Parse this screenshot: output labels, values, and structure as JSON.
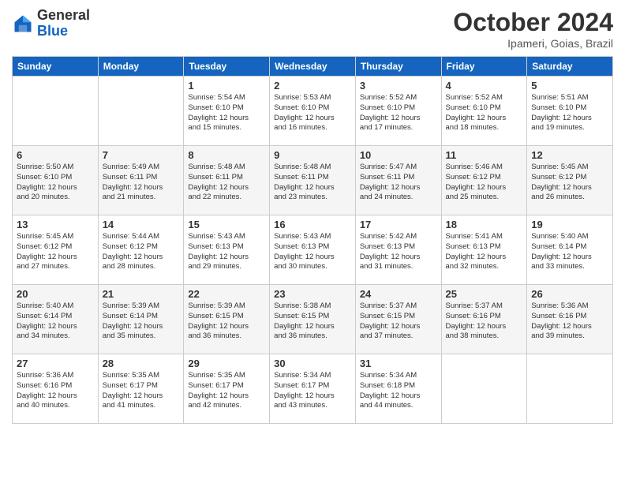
{
  "header": {
    "logo_line1": "General",
    "logo_line2": "Blue",
    "month": "October 2024",
    "location": "Ipameri, Goias, Brazil"
  },
  "days_of_week": [
    "Sunday",
    "Monday",
    "Tuesday",
    "Wednesday",
    "Thursday",
    "Friday",
    "Saturday"
  ],
  "weeks": [
    [
      {
        "day": "",
        "info": ""
      },
      {
        "day": "",
        "info": ""
      },
      {
        "day": "1",
        "info": "Sunrise: 5:54 AM\nSunset: 6:10 PM\nDaylight: 12 hours\nand 15 minutes."
      },
      {
        "day": "2",
        "info": "Sunrise: 5:53 AM\nSunset: 6:10 PM\nDaylight: 12 hours\nand 16 minutes."
      },
      {
        "day": "3",
        "info": "Sunrise: 5:52 AM\nSunset: 6:10 PM\nDaylight: 12 hours\nand 17 minutes."
      },
      {
        "day": "4",
        "info": "Sunrise: 5:52 AM\nSunset: 6:10 PM\nDaylight: 12 hours\nand 18 minutes."
      },
      {
        "day": "5",
        "info": "Sunrise: 5:51 AM\nSunset: 6:10 PM\nDaylight: 12 hours\nand 19 minutes."
      }
    ],
    [
      {
        "day": "6",
        "info": "Sunrise: 5:50 AM\nSunset: 6:10 PM\nDaylight: 12 hours\nand 20 minutes."
      },
      {
        "day": "7",
        "info": "Sunrise: 5:49 AM\nSunset: 6:11 PM\nDaylight: 12 hours\nand 21 minutes."
      },
      {
        "day": "8",
        "info": "Sunrise: 5:48 AM\nSunset: 6:11 PM\nDaylight: 12 hours\nand 22 minutes."
      },
      {
        "day": "9",
        "info": "Sunrise: 5:48 AM\nSunset: 6:11 PM\nDaylight: 12 hours\nand 23 minutes."
      },
      {
        "day": "10",
        "info": "Sunrise: 5:47 AM\nSunset: 6:11 PM\nDaylight: 12 hours\nand 24 minutes."
      },
      {
        "day": "11",
        "info": "Sunrise: 5:46 AM\nSunset: 6:12 PM\nDaylight: 12 hours\nand 25 minutes."
      },
      {
        "day": "12",
        "info": "Sunrise: 5:45 AM\nSunset: 6:12 PM\nDaylight: 12 hours\nand 26 minutes."
      }
    ],
    [
      {
        "day": "13",
        "info": "Sunrise: 5:45 AM\nSunset: 6:12 PM\nDaylight: 12 hours\nand 27 minutes."
      },
      {
        "day": "14",
        "info": "Sunrise: 5:44 AM\nSunset: 6:12 PM\nDaylight: 12 hours\nand 28 minutes."
      },
      {
        "day": "15",
        "info": "Sunrise: 5:43 AM\nSunset: 6:13 PM\nDaylight: 12 hours\nand 29 minutes."
      },
      {
        "day": "16",
        "info": "Sunrise: 5:43 AM\nSunset: 6:13 PM\nDaylight: 12 hours\nand 30 minutes."
      },
      {
        "day": "17",
        "info": "Sunrise: 5:42 AM\nSunset: 6:13 PM\nDaylight: 12 hours\nand 31 minutes."
      },
      {
        "day": "18",
        "info": "Sunrise: 5:41 AM\nSunset: 6:13 PM\nDaylight: 12 hours\nand 32 minutes."
      },
      {
        "day": "19",
        "info": "Sunrise: 5:40 AM\nSunset: 6:14 PM\nDaylight: 12 hours\nand 33 minutes."
      }
    ],
    [
      {
        "day": "20",
        "info": "Sunrise: 5:40 AM\nSunset: 6:14 PM\nDaylight: 12 hours\nand 34 minutes."
      },
      {
        "day": "21",
        "info": "Sunrise: 5:39 AM\nSunset: 6:14 PM\nDaylight: 12 hours\nand 35 minutes."
      },
      {
        "day": "22",
        "info": "Sunrise: 5:39 AM\nSunset: 6:15 PM\nDaylight: 12 hours\nand 36 minutes."
      },
      {
        "day": "23",
        "info": "Sunrise: 5:38 AM\nSunset: 6:15 PM\nDaylight: 12 hours\nand 36 minutes."
      },
      {
        "day": "24",
        "info": "Sunrise: 5:37 AM\nSunset: 6:15 PM\nDaylight: 12 hours\nand 37 minutes."
      },
      {
        "day": "25",
        "info": "Sunrise: 5:37 AM\nSunset: 6:16 PM\nDaylight: 12 hours\nand 38 minutes."
      },
      {
        "day": "26",
        "info": "Sunrise: 5:36 AM\nSunset: 6:16 PM\nDaylight: 12 hours\nand 39 minutes."
      }
    ],
    [
      {
        "day": "27",
        "info": "Sunrise: 5:36 AM\nSunset: 6:16 PM\nDaylight: 12 hours\nand 40 minutes."
      },
      {
        "day": "28",
        "info": "Sunrise: 5:35 AM\nSunset: 6:17 PM\nDaylight: 12 hours\nand 41 minutes."
      },
      {
        "day": "29",
        "info": "Sunrise: 5:35 AM\nSunset: 6:17 PM\nDaylight: 12 hours\nand 42 minutes."
      },
      {
        "day": "30",
        "info": "Sunrise: 5:34 AM\nSunset: 6:17 PM\nDaylight: 12 hours\nand 43 minutes."
      },
      {
        "day": "31",
        "info": "Sunrise: 5:34 AM\nSunset: 6:18 PM\nDaylight: 12 hours\nand 44 minutes."
      },
      {
        "day": "",
        "info": ""
      },
      {
        "day": "",
        "info": ""
      }
    ]
  ]
}
